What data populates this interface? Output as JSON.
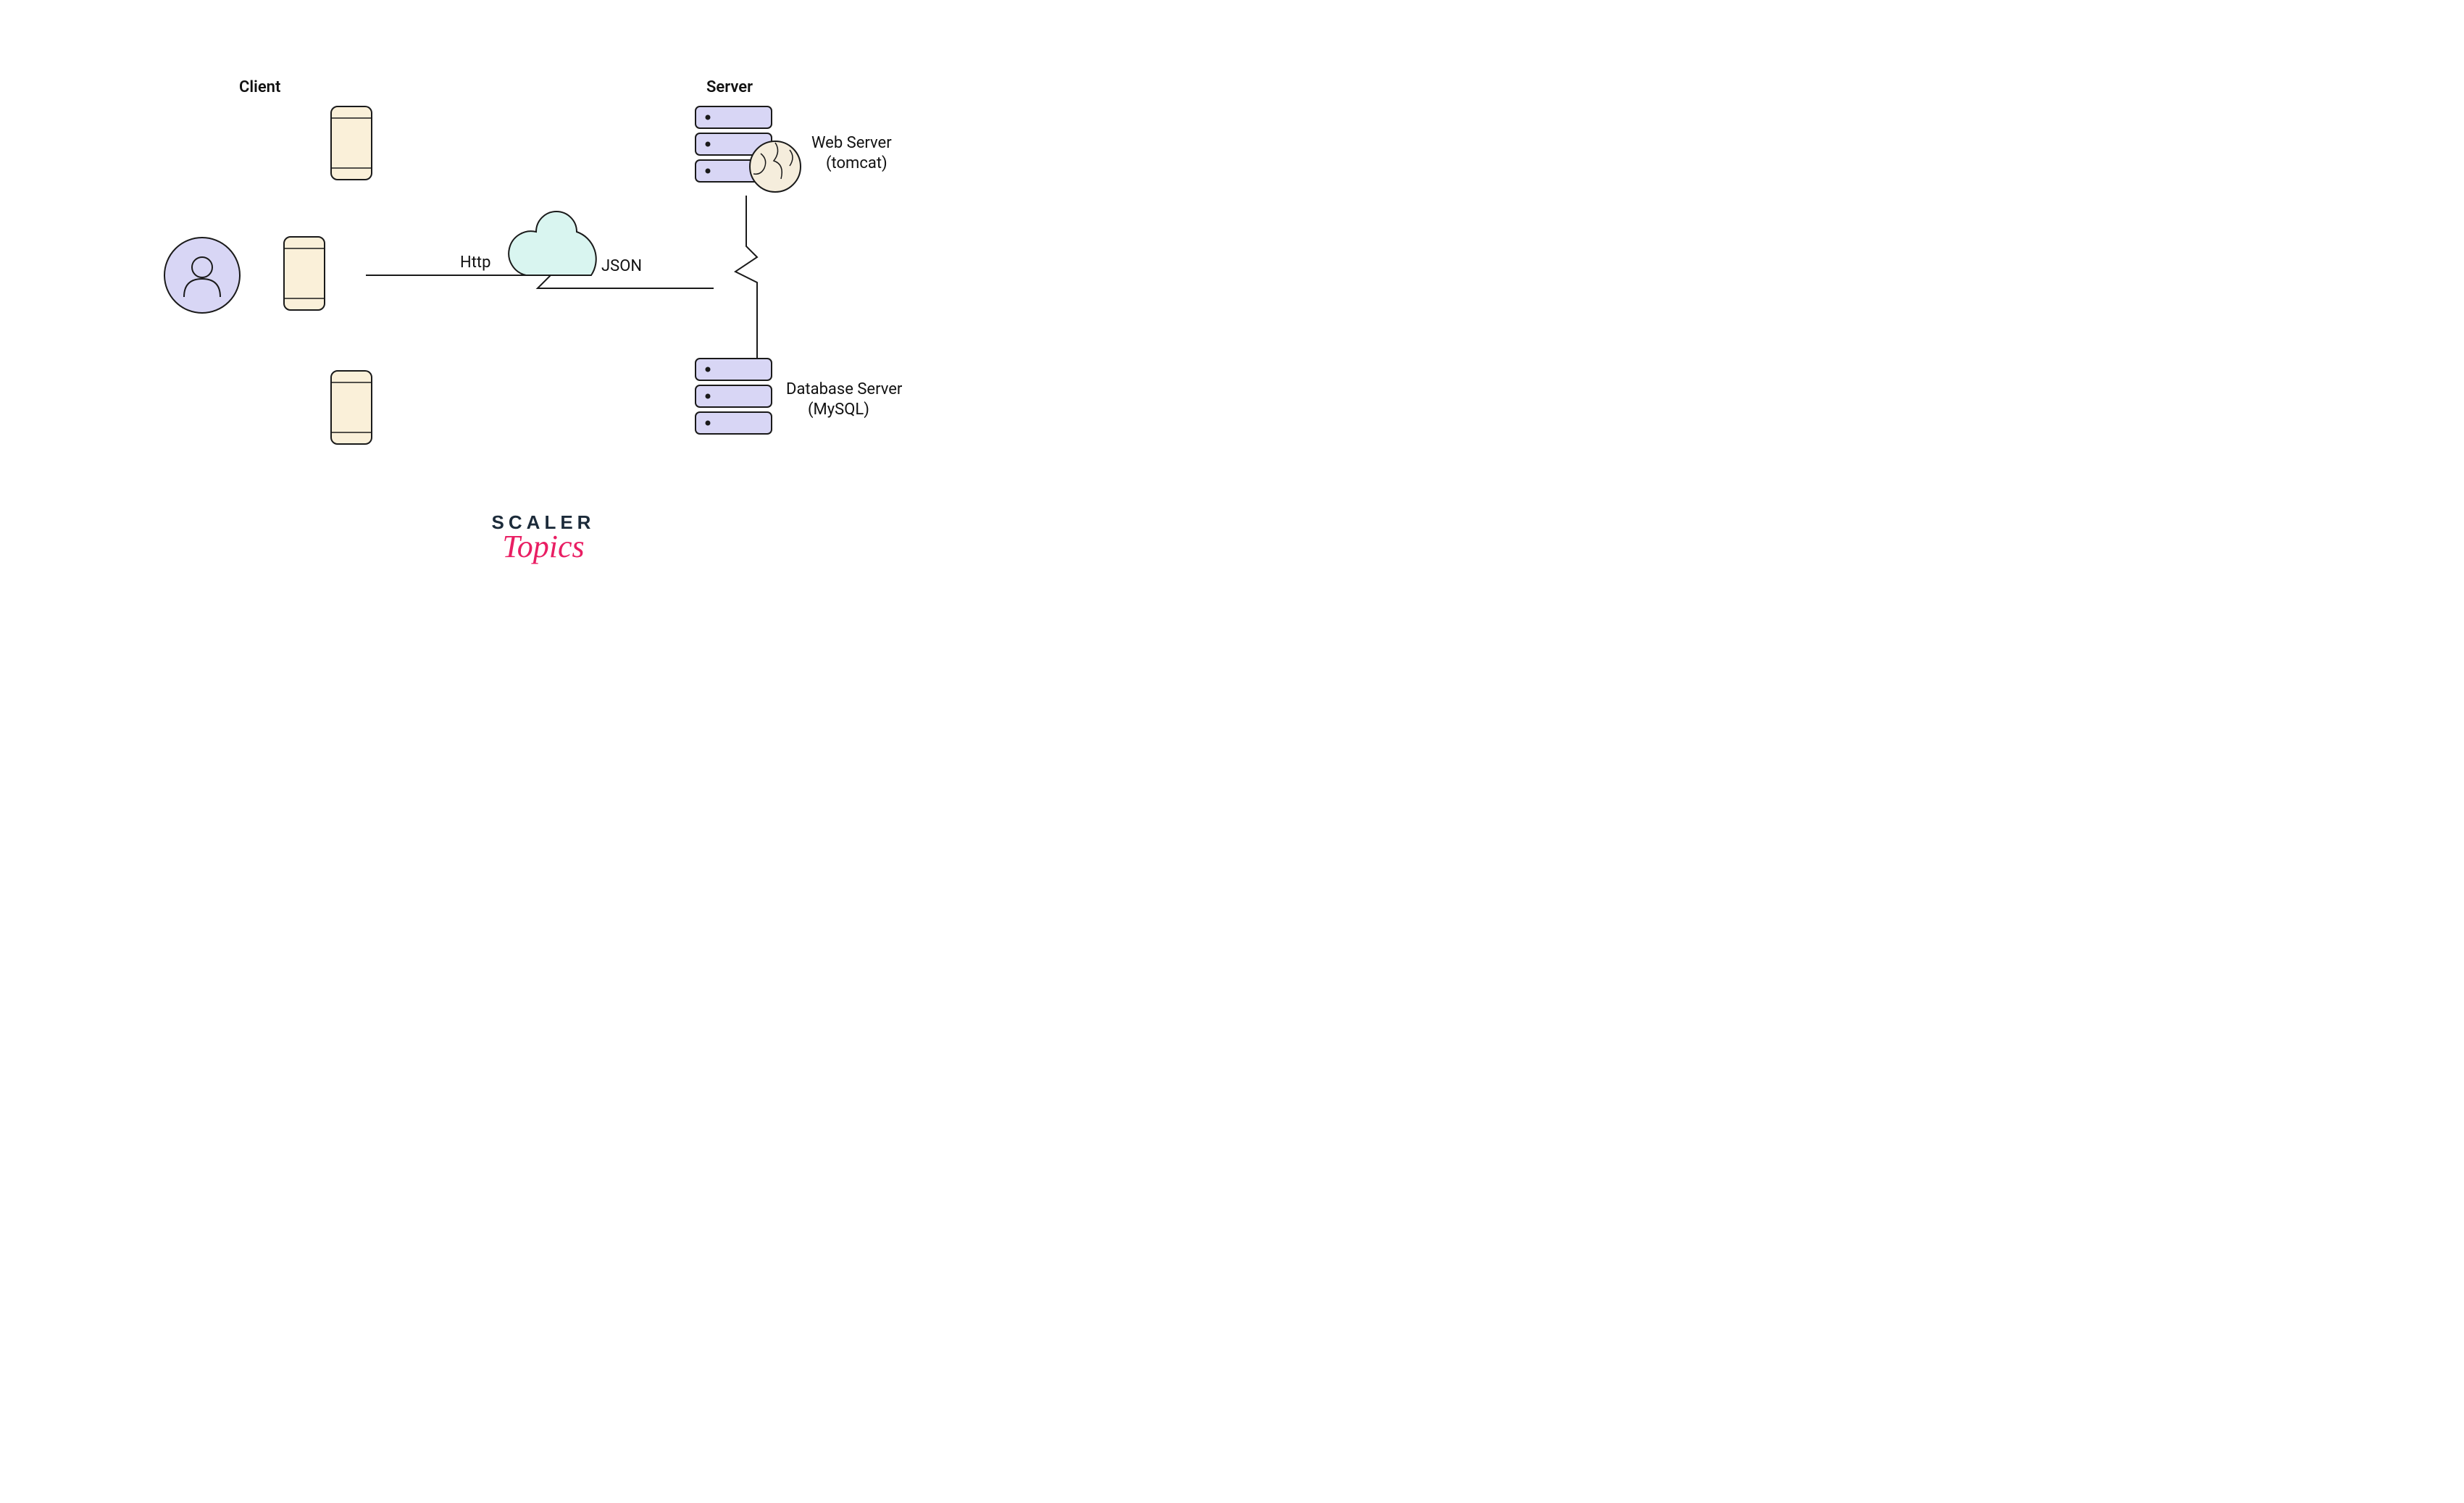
{
  "labels": {
    "client": "Client",
    "server": "Server",
    "http": "Http",
    "json": "JSON",
    "webserver_line1": "Web Server",
    "webserver_line2": "(tomcat)",
    "dbserver_line1": "Database Server",
    "dbserver_line2": "(MySQL)"
  },
  "footer": {
    "top": "SCALER",
    "bottom": "Topics"
  },
  "colors": {
    "phone": "#faf0d9",
    "user_fill": "#d8d6f5",
    "server_fill": "#d8d6f5",
    "cloud": "#d9f5f0",
    "globe": "#f5eddc",
    "stroke": "#1a1a1a"
  }
}
